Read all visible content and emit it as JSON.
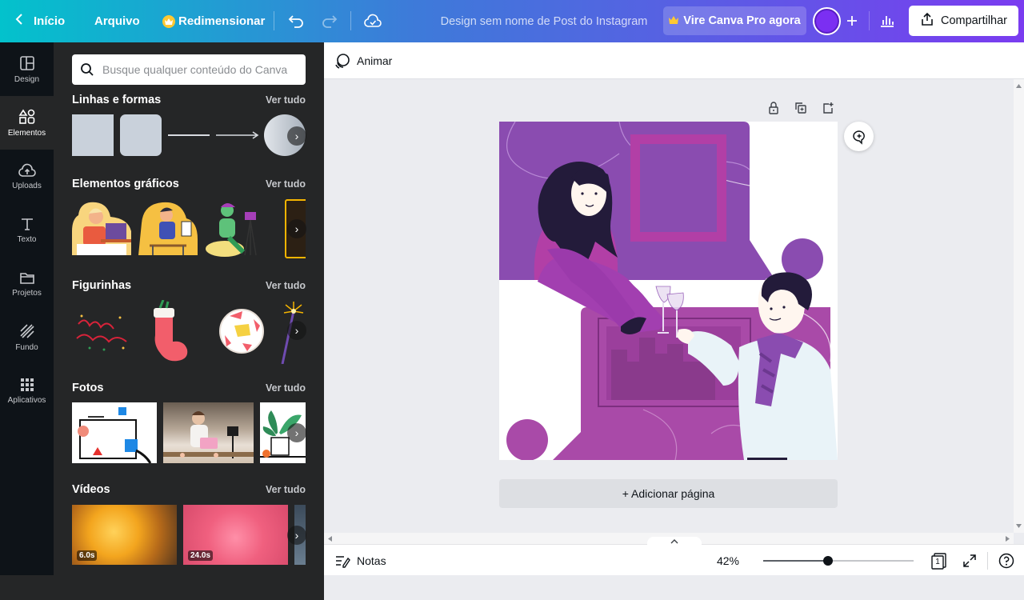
{
  "topbar": {
    "back_label": "Início",
    "file_label": "Arquivo",
    "resize_label": "Redimensionar",
    "design_title": "Design sem nome de Post do Instagram",
    "pro_label": "Vire Canva Pro agora",
    "share_label": "Compartilhar",
    "brand_gradient": [
      "#03c2cc",
      "#7a3cf0"
    ]
  },
  "rail": {
    "items": [
      {
        "label": "Design",
        "icon": "layout-icon"
      },
      {
        "label": "Elementos",
        "icon": "shapes-icon"
      },
      {
        "label": "Uploads",
        "icon": "cloud-upload-icon"
      },
      {
        "label": "Texto",
        "icon": "text-icon"
      },
      {
        "label": "Projetos",
        "icon": "folder-icon"
      },
      {
        "label": "Fundo",
        "icon": "pattern-icon"
      },
      {
        "label": "Aplicativos",
        "icon": "apps-icon"
      }
    ]
  },
  "panel": {
    "search_placeholder": "Busque qualquer conteúdo do Canva",
    "see_all": "Ver tudo",
    "sections": [
      {
        "title": "Linhas e formas"
      },
      {
        "title": "Elementos gráficos"
      },
      {
        "title": "Figurinhas"
      },
      {
        "title": "Fotos"
      },
      {
        "title": "Vídeos"
      }
    ],
    "videos": [
      {
        "duration": "6.0s"
      },
      {
        "duration": "24.0s"
      }
    ]
  },
  "editor": {
    "animate_label": "Animar",
    "add_page_label": "+ Adicionar página",
    "notes_label": "Notas",
    "zoom": "42%",
    "zoom_fraction": 0.42,
    "page_number": "1"
  }
}
